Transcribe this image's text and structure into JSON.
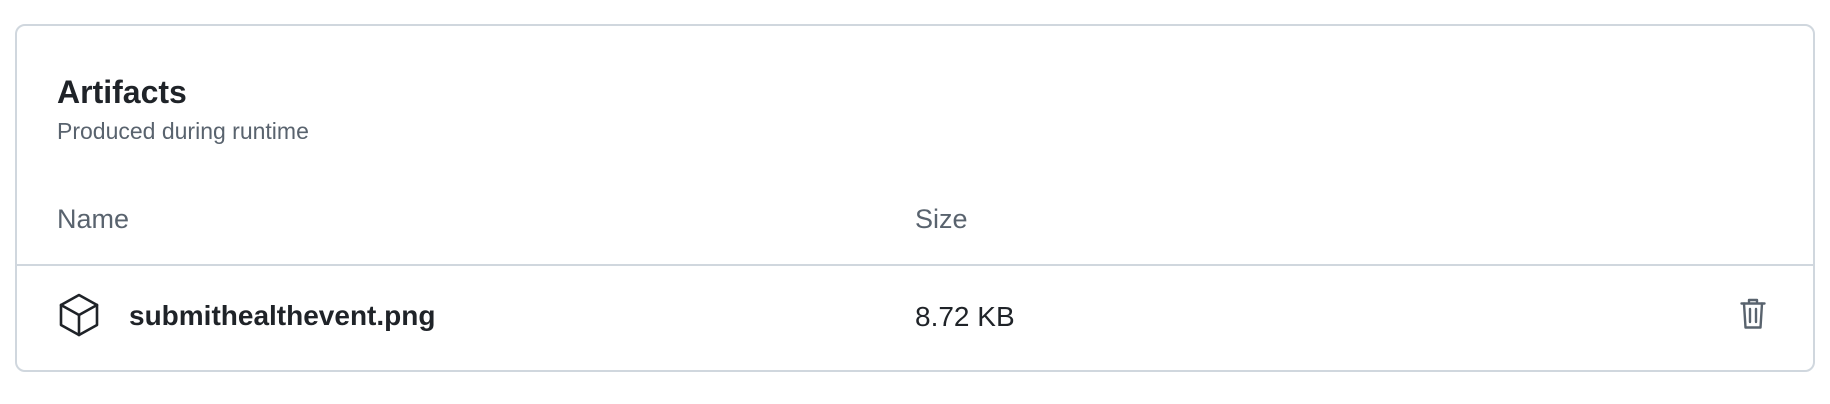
{
  "artifacts": {
    "title": "Artifacts",
    "subtitle": "Produced during runtime",
    "columns": {
      "name": "Name",
      "size": "Size"
    },
    "items": [
      {
        "icon": "package-icon",
        "name": "submithealthevent.png",
        "size": "8.72 KB",
        "action_icon": "trash-icon"
      }
    ]
  },
  "colors": {
    "border": "#d0d7de",
    "text_primary": "#1f2328",
    "text_muted": "#59636e"
  }
}
